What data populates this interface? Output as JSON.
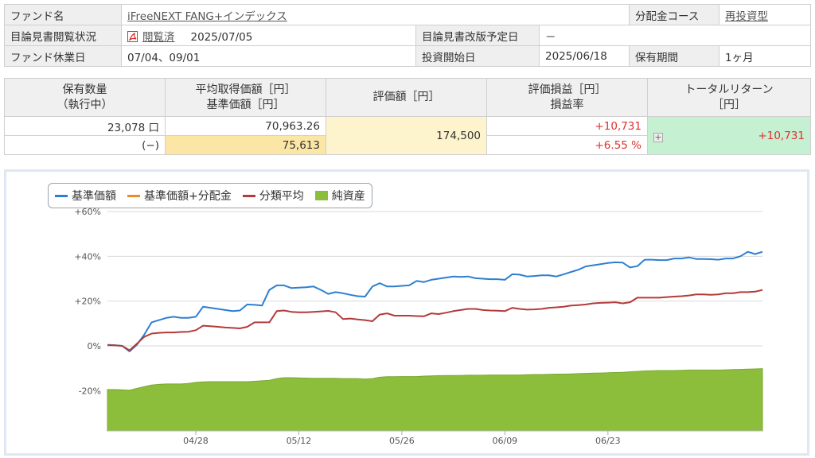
{
  "fund_info": {
    "fund_name_label": "ファンド名",
    "fund_name": "iFreeNEXT FANG+インデックス",
    "dist_course_label": "分配金コース",
    "dist_course": "再投資型",
    "prospectus_status_label": "目論見書閲覧状況",
    "prospectus_status": "閲覧済",
    "prospectus_date": "2025/07/05",
    "prospectus_revision_label": "目論見書改版予定日",
    "prospectus_revision": "－",
    "holidays_label": "ファンド休業日",
    "holidays": "07/04、09/01",
    "invest_start_label": "投資開始日",
    "invest_start": "2025/06/18",
    "holding_period_label": "保有期間",
    "holding_period": "1ヶ月"
  },
  "holdings": {
    "headers": {
      "qty": "保有数量",
      "qty_sub": "（執行中）",
      "avg_cost": "平均取得価額［円］",
      "nav": "基準価額［円］",
      "valuation": "評価額［円］",
      "pnl": "評価損益［円］",
      "pnl_rate": "損益率",
      "total_return": "トータルリターン",
      "total_return_unit": "［円］"
    },
    "qty": "23,078 口",
    "qty_executing": "(−)",
    "avg_cost": "70,963.26",
    "nav": "75,613",
    "valuation": "174,500",
    "pnl": "+10,731",
    "pnl_rate": "+6.55 %",
    "total_return": "+10,731"
  },
  "legend": [
    {
      "label": "基準価額",
      "color": "#2e7fd1",
      "type": "line"
    },
    {
      "label": "基準価額+分配金",
      "color": "#f08a24",
      "type": "line"
    },
    {
      "label": "分類平均",
      "color": "#b33b3b",
      "type": "line"
    },
    {
      "label": "純資産",
      "color": "#8dbe3b",
      "type": "area"
    }
  ],
  "chart_data": {
    "type": "line",
    "y_ticks": [
      "+60%",
      "+40%",
      "+20%",
      "0%",
      "-20%"
    ],
    "ylim": [
      -38,
      60
    ],
    "x_ticks": [
      "04/28",
      "05/12",
      "05/26",
      "06/09",
      "06/23"
    ],
    "x_tick_index": [
      12,
      26,
      40,
      54,
      68
    ],
    "n_points": 90,
    "grid": true,
    "legend_position": "top-left",
    "series": [
      {
        "name": "基準価額",
        "color": "#2e7fd1",
        "values": [
          0.5,
          0.3,
          0,
          -2.5,
          0.5,
          5,
          10.5,
          11.5,
          12.5,
          13,
          12.5,
          12.5,
          13,
          17.5,
          17,
          16.5,
          16,
          15.5,
          15.8,
          18.5,
          18.3,
          18,
          25,
          27,
          27,
          25.8,
          26,
          26.2,
          26.5,
          25,
          23.2,
          24,
          23.5,
          22.8,
          22.2,
          22,
          26.5,
          28,
          26.5,
          26.5,
          26.8,
          27,
          29,
          28.5,
          29.5,
          30,
          30.5,
          31,
          30.8,
          31,
          30.2,
          30,
          29.8,
          29.8,
          29.5,
          32,
          31.8,
          31,
          31.2,
          31.5,
          31.5,
          31,
          32,
          33,
          34,
          35.5,
          36,
          36.5,
          37,
          37.3,
          37.2,
          35,
          35.6,
          38.5,
          38.5,
          38.3,
          38.3,
          39,
          39,
          39.5,
          38.8,
          38.8,
          38.7,
          38.5,
          39,
          39,
          40,
          42,
          41,
          42
        ]
      },
      {
        "name": "分類平均",
        "color": "#b33b3b",
        "values": [
          0.3,
          0.2,
          0,
          -2,
          1,
          4,
          5.5,
          5.8,
          6,
          6,
          6.2,
          6.3,
          7,
          9,
          8.8,
          8.5,
          8.2,
          8,
          7.8,
          8.5,
          10.5,
          10.5,
          10.5,
          15.5,
          15.8,
          15.2,
          15,
          15,
          15.2,
          15.4,
          15.6,
          15,
          12,
          12.2,
          11.8,
          11.5,
          11,
          14,
          14.5,
          13.5,
          13.5,
          13.5,
          13.3,
          13.2,
          14.5,
          14.2,
          14.8,
          15.5,
          16,
          16.5,
          16.5,
          16,
          15.8,
          15.7,
          15.5,
          17,
          16.5,
          16.2,
          16.3,
          16.5,
          17,
          17.2,
          17.5,
          18,
          18.2,
          18.5,
          19,
          19.2,
          19.3,
          19.5,
          19,
          19.5,
          21.5,
          21.5,
          21.5,
          21.5,
          21.8,
          22,
          22.2,
          22.5,
          23,
          23,
          22.8,
          23,
          23.5,
          23.5,
          24,
          24,
          24.2,
          25
        ]
      },
      {
        "name": "純資産",
        "color": "#8dbe3b",
        "type": "area",
        "values": [
          -19.5,
          -19.5,
          -19.6,
          -19.8,
          -19,
          -18.2,
          -17.5,
          -17.2,
          -17,
          -17,
          -17,
          -16.8,
          -16.3,
          -16.1,
          -16,
          -16,
          -16,
          -16,
          -16,
          -16,
          -15.8,
          -15.6,
          -15.4,
          -14.6,
          -14.2,
          -14.2,
          -14.3,
          -14.4,
          -14.5,
          -14.5,
          -14.5,
          -14.5,
          -14.6,
          -14.6,
          -14.6,
          -14.8,
          -14.6,
          -14,
          -13.8,
          -13.8,
          -13.7,
          -13.7,
          -13.7,
          -13.5,
          -13.4,
          -13.3,
          -13.2,
          -13.2,
          -13.2,
          -13.1,
          -13.1,
          -13.1,
          -13,
          -13,
          -13,
          -13,
          -13,
          -12.9,
          -12.8,
          -12.8,
          -12.7,
          -12.6,
          -12.6,
          -12.5,
          -12.4,
          -12.3,
          -12.2,
          -12.1,
          -12,
          -11.9,
          -11.8,
          -11.6,
          -11.4,
          -11.2,
          -11.1,
          -11,
          -11,
          -11,
          -10.9,
          -10.8,
          -10.8,
          -10.8,
          -10.8,
          -10.8,
          -10.7,
          -10.6,
          -10.5,
          -10.4,
          -10.3,
          -10.2
        ]
      }
    ]
  }
}
